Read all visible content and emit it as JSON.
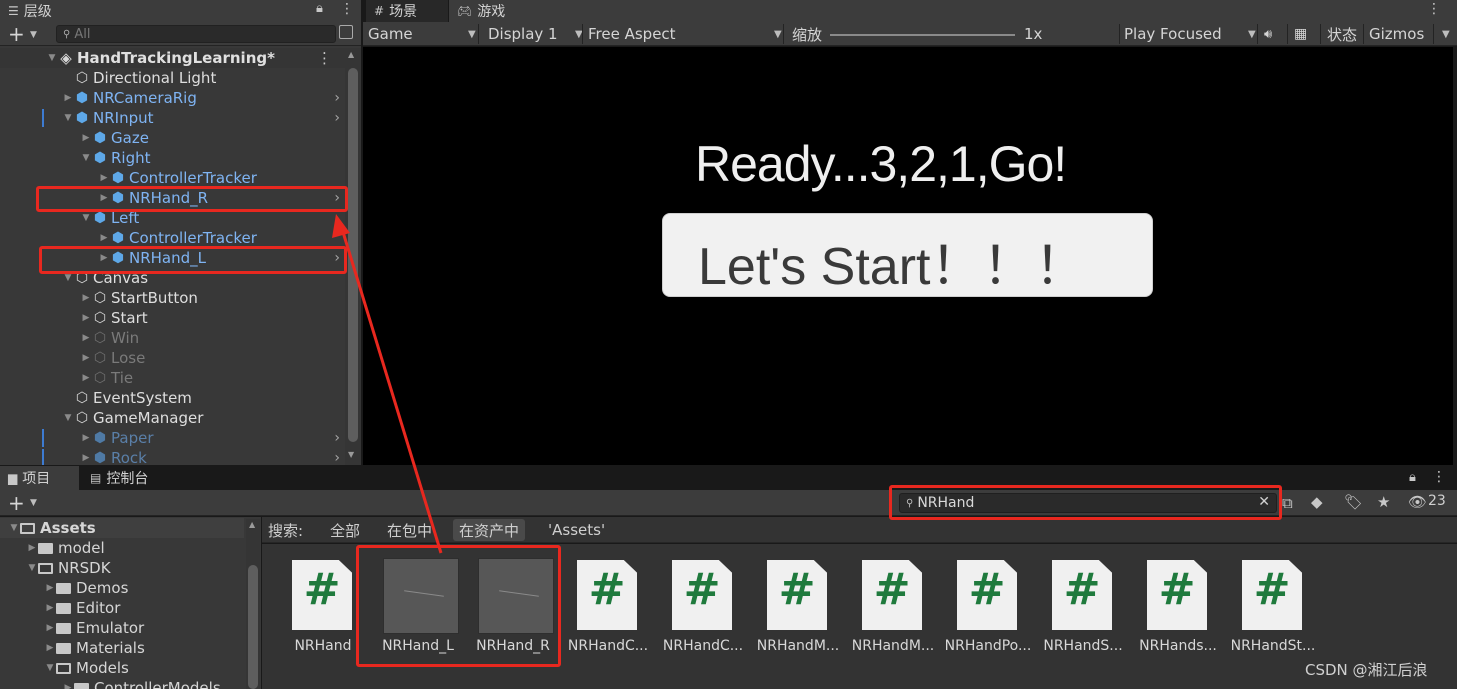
{
  "top_tabs": {
    "hierarchy": "层级",
    "scene": "场景",
    "game": "游戏"
  },
  "hierarchy": {
    "add_label": "+",
    "search_placeholder": "All",
    "scene_name": "HandTrackingLearning*",
    "items": [
      {
        "label": "Directional Light",
        "depth": 1,
        "style": "white",
        "expand": "none",
        "chevron": false
      },
      {
        "label": "NRCameraRig",
        "depth": 1,
        "style": "blue",
        "expand": "collapsed",
        "chevron": true
      },
      {
        "label": "NRInput",
        "depth": 1,
        "style": "blue",
        "expand": "expanded",
        "chevron": true
      },
      {
        "label": "Gaze",
        "depth": 2,
        "style": "blue",
        "expand": "collapsed",
        "chevron": false
      },
      {
        "label": "Right",
        "depth": 2,
        "style": "blue",
        "expand": "expanded",
        "chevron": false
      },
      {
        "label": "ControllerTracker",
        "depth": 3,
        "style": "blue",
        "expand": "collapsed",
        "chevron": false
      },
      {
        "label": "NRHand_R",
        "depth": 3,
        "style": "blue",
        "expand": "collapsed",
        "chevron": true
      },
      {
        "label": "Left",
        "depth": 2,
        "style": "blue",
        "expand": "expanded",
        "chevron": false
      },
      {
        "label": "ControllerTracker",
        "depth": 3,
        "style": "blue",
        "expand": "collapsed",
        "chevron": false
      },
      {
        "label": "NRHand_L",
        "depth": 3,
        "style": "blue",
        "expand": "collapsed",
        "chevron": true
      },
      {
        "label": "Canvas",
        "depth": 1,
        "style": "white",
        "expand": "expanded",
        "chevron": false
      },
      {
        "label": "StartButton",
        "depth": 2,
        "style": "white",
        "expand": "collapsed",
        "chevron": false
      },
      {
        "label": "Start",
        "depth": 2,
        "style": "white",
        "expand": "collapsed",
        "chevron": false
      },
      {
        "label": "Win",
        "depth": 2,
        "style": "dim",
        "expand": "collapsed",
        "chevron": false
      },
      {
        "label": "Lose",
        "depth": 2,
        "style": "dim",
        "expand": "collapsed",
        "chevron": false
      },
      {
        "label": "Tie",
        "depth": 2,
        "style": "dim",
        "expand": "collapsed",
        "chevron": false
      },
      {
        "label": "EventSystem",
        "depth": 1,
        "style": "white",
        "expand": "none",
        "chevron": false
      },
      {
        "label": "GameManager",
        "depth": 1,
        "style": "white",
        "expand": "expanded",
        "chevron": false
      },
      {
        "label": "Paper",
        "depth": 2,
        "style": "dimblue",
        "expand": "collapsed",
        "chevron": true
      },
      {
        "label": "Rock",
        "depth": 2,
        "style": "dimblue",
        "expand": "collapsed",
        "chevron": true
      }
    ]
  },
  "game_toolbar": {
    "display_mode": "Game",
    "display": "Display 1",
    "aspect": "Free Aspect",
    "scale_label": "缩放",
    "scale_value": "1x",
    "play_mode": "Play Focused",
    "stats": "状态",
    "gizmos": "Gizmos"
  },
  "game_view": {
    "ready_text": "Ready...3,2,1,Go!",
    "start_button": "Let's Start！！！"
  },
  "project_tabs": {
    "project": "项目",
    "console": "控制台"
  },
  "project_toolbar": {
    "add_label": "+",
    "search_value": "NRHand",
    "hidden_count": "23"
  },
  "search_filters": {
    "label": "搜索:",
    "all": "全部",
    "in_packages": "在包中",
    "in_assets": "在资产中",
    "assets_folder": "'Assets'"
  },
  "assets_tree": {
    "items": [
      {
        "label": "Assets",
        "depth": 0,
        "open": true
      },
      {
        "label": "model",
        "depth": 1,
        "open": false
      },
      {
        "label": "NRSDK",
        "depth": 1,
        "open": true
      },
      {
        "label": "Demos",
        "depth": 2,
        "open": false
      },
      {
        "label": "Editor",
        "depth": 2,
        "open": false
      },
      {
        "label": "Emulator",
        "depth": 2,
        "open": false
      },
      {
        "label": "Materials",
        "depth": 2,
        "open": false
      },
      {
        "label": "Models",
        "depth": 2,
        "open": true
      },
      {
        "label": "ControllerModels",
        "depth": 3,
        "open": false
      }
    ]
  },
  "assets_grid": [
    {
      "label": "NRHand",
      "kind": "script"
    },
    {
      "label": "NRHand_L",
      "kind": "prefab"
    },
    {
      "label": "NRHand_R",
      "kind": "prefab"
    },
    {
      "label": "NRHandC...",
      "kind": "script"
    },
    {
      "label": "NRHandC...",
      "kind": "script"
    },
    {
      "label": "NRHandM...",
      "kind": "script"
    },
    {
      "label": "NRHandM...",
      "kind": "script"
    },
    {
      "label": "NRHandPo...",
      "kind": "script"
    },
    {
      "label": "NRHandS...",
      "kind": "script"
    },
    {
      "label": "NRHands...",
      "kind": "script"
    },
    {
      "label": "NRHandSt...",
      "kind": "script"
    }
  ],
  "colors": {
    "annotation_red": "#e8281f",
    "prefab_blue": "#7fb4f3",
    "script_green": "#1f7a3d"
  },
  "watermark": "CSDN @湘江后浪"
}
